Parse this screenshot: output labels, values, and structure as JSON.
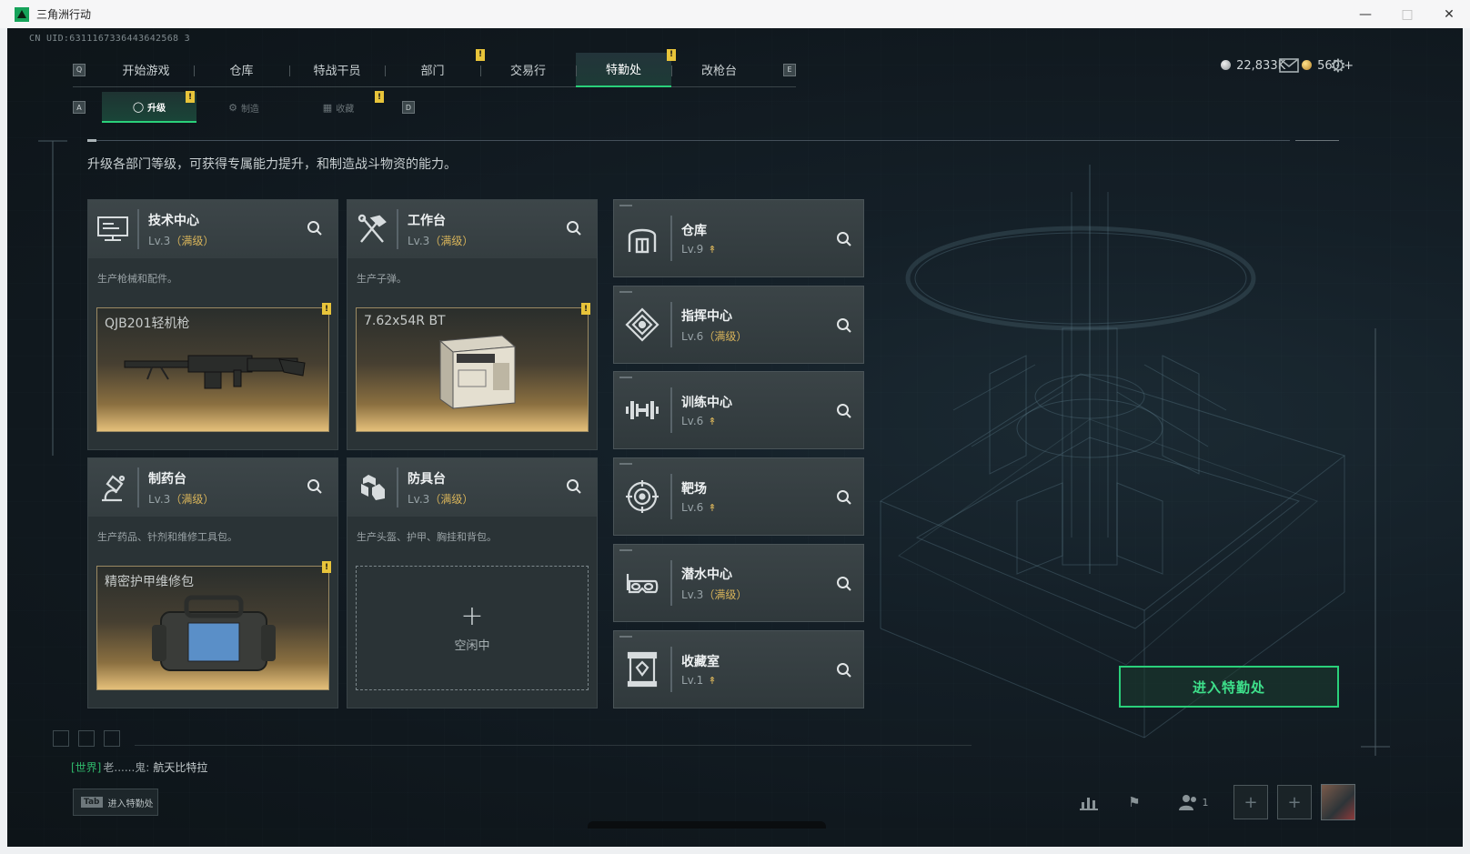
{
  "window": {
    "title": "三角洲行动",
    "controls": [
      "minimize-icon",
      "maximize-icon",
      "close-icon"
    ]
  },
  "uid": "CN UID:6311167336443642568 3",
  "top_nav": {
    "left_key": "Q",
    "right_key": "E",
    "tabs": [
      {
        "label": "开始游戏",
        "alert": false
      },
      {
        "label": "仓库",
        "alert": false
      },
      {
        "label": "特战干员",
        "alert": false
      },
      {
        "label": "部门",
        "alert": true
      },
      {
        "label": "交易行",
        "alert": false
      },
      {
        "label": "特勤处",
        "alert": true,
        "active": true
      },
      {
        "label": "改枪台",
        "alert": false
      }
    ]
  },
  "currencies": {
    "silver": "22,833K",
    "gold": "560"
  },
  "sub_nav": {
    "left_key": "A",
    "right_key": "D",
    "tabs": [
      {
        "label": "升级",
        "icon": "upgrade-icon",
        "active": true,
        "alert": true
      },
      {
        "label": "制造",
        "icon": "craft-icon",
        "active": false,
        "alert": false
      },
      {
        "label": "收藏",
        "icon": "collect-icon",
        "active": false,
        "alert": true
      }
    ]
  },
  "description": "升级各部门等级，可获得专属能力提升，和制造战斗物资的能力。",
  "production_cards": [
    {
      "name": "技术中心",
      "level": "Lv.3",
      "maxed": "（满级）",
      "desc": "生产枪械和配件。",
      "item": "QJB201轻机枪",
      "icon": "tech-center-icon",
      "alert": true
    },
    {
      "name": "工作台",
      "level": "Lv.3",
      "maxed": "（满级）",
      "desc": "生产子弹。",
      "item": "7.62x54R BT",
      "icon": "workbench-icon",
      "alert": true
    },
    {
      "name": "制药台",
      "level": "Lv.3",
      "maxed": "（满级）",
      "desc": "生产药品、针剂和维修工具包。",
      "item": "精密护甲维修包",
      "icon": "pharmacy-icon",
      "alert": true
    },
    {
      "name": "防具台",
      "level": "Lv.3",
      "maxed": "（满级）",
      "desc": "生产头盔、护甲、胸挂和背包。",
      "idle": "空闲中",
      "icon": "armor-bench-icon"
    }
  ],
  "facilities": [
    {
      "name": "仓库",
      "level": "Lv.9",
      "maxed": "",
      "upgradable": true,
      "icon": "warehouse-icon"
    },
    {
      "name": "指挥中心",
      "level": "Lv.6",
      "maxed": "（满级）",
      "upgradable": false,
      "icon": "command-center-icon"
    },
    {
      "name": "训练中心",
      "level": "Lv.6",
      "maxed": "",
      "upgradable": true,
      "icon": "training-center-icon"
    },
    {
      "name": "靶场",
      "level": "Lv.6",
      "maxed": "",
      "upgradable": true,
      "icon": "shooting-range-icon"
    },
    {
      "name": "潜水中心",
      "level": "Lv.3",
      "maxed": "（满级）",
      "upgradable": false,
      "icon": "diving-center-icon"
    },
    {
      "name": "收藏室",
      "level": "Lv.1",
      "maxed": "",
      "upgradable": true,
      "icon": "collection-room-icon"
    }
  ],
  "enter_button": "进入特勤处",
  "chat": {
    "channel": "[世界]",
    "user": "老......鬼:",
    "message": "航天比特拉"
  },
  "tab_hint": {
    "key": "Tab",
    "label": "进入特勤处"
  },
  "bottom": {
    "friends_count": "1"
  },
  "colors": {
    "accent": "#2ad07a",
    "alert": "#e8c43a",
    "maxed": "#d7b35a"
  }
}
